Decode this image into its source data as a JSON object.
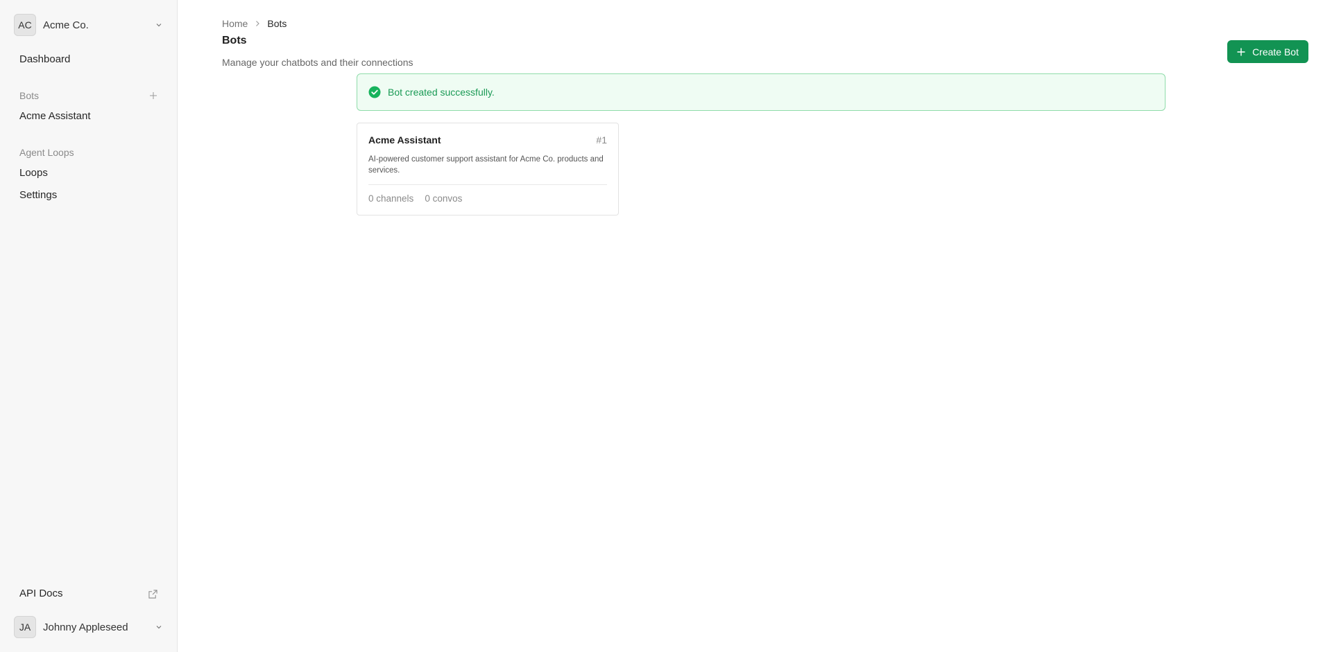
{
  "org": {
    "initials": "AC",
    "name": "Acme Co."
  },
  "nav": {
    "dashboard": "Dashboard",
    "bots_section": "Bots",
    "bots_items": [
      "Acme Assistant"
    ],
    "agent_loops_section": "Agent Loops",
    "loops": "Loops",
    "settings": "Settings",
    "api_docs": "API Docs"
  },
  "user": {
    "initials": "JA",
    "name": "Johnny Appleseed"
  },
  "breadcrumb": {
    "home": "Home",
    "current": "Bots"
  },
  "page": {
    "title": "Bots",
    "subtitle": "Manage your chatbots and their connections",
    "create_label": "Create Bot"
  },
  "alert": {
    "message": "Bot created successfully."
  },
  "bots": [
    {
      "name": "Acme Assistant",
      "id_label": "#1",
      "description": "AI-powered customer support assistant for Acme Co. products and services.",
      "channels": "0 channels",
      "convos": "0 convos"
    }
  ],
  "colors": {
    "accent": "#129353",
    "success_bg": "#effcf3",
    "success_border": "#8fdcaa",
    "success_text": "#1a9a55"
  }
}
